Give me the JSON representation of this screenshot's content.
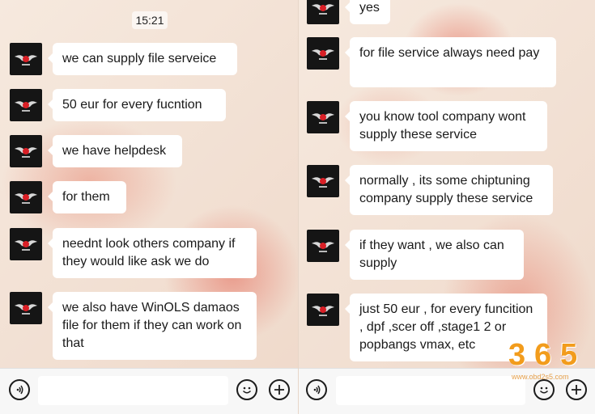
{
  "left": {
    "timestamp": "15:21",
    "messages": [
      {
        "text": "we can supply file serveice"
      },
      {
        "text": "50 eur for every fucntion"
      },
      {
        "text": "we have helpdesk"
      },
      {
        "text": "for them"
      },
      {
        "text": "neednt look others company if they would like ask we do"
      },
      {
        "text": "we also have WinOLS damaos file for them if they can work on that"
      }
    ]
  },
  "right": {
    "messages": [
      {
        "text": "yes"
      },
      {
        "text": "for file service always need pay"
      },
      {
        "text": "you know tool company wont supply these service"
      },
      {
        "text": "normally , its some chiptuning company supply these service"
      },
      {
        "text": "if they want , we also can supply"
      },
      {
        "text": "just 50 eur , for every funcition , dpf ,scer off ,stage1 2 or popbangs vmax, etc"
      }
    ]
  },
  "watermark": {
    "digits": [
      "3",
      "6",
      "5"
    ],
    "url": "www.obd2s5.com"
  },
  "icons": {
    "voice": "voice-icon",
    "emoji": "emoji-icon",
    "add": "plus-icon",
    "avatar": "winged-logo-icon"
  },
  "colors": {
    "bubble": "#ffffff",
    "input_bar": "#f7f7f7",
    "avatar_bg": "#151515",
    "watermark": "#f29c1c"
  }
}
